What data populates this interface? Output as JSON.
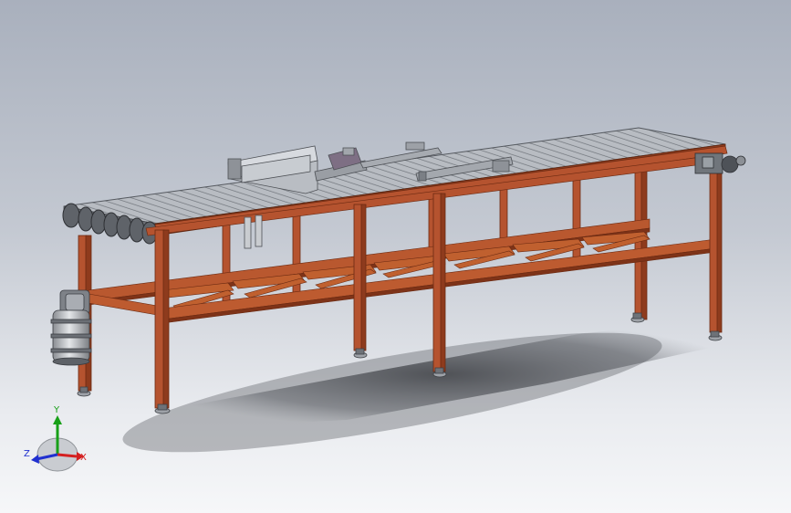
{
  "viewport": {
    "background_top": "#a9b0bd",
    "background_bottom": "#f6f7f9",
    "frame_color": "#b5532f",
    "frame_dark": "#7a3218",
    "belt_color": "#9a9ea4"
  },
  "triad": {
    "x_label": "X",
    "y_label": "Y",
    "z_label": "Z",
    "x_color": "#d42020",
    "y_color": "#18a018",
    "z_color": "#2030d0"
  }
}
